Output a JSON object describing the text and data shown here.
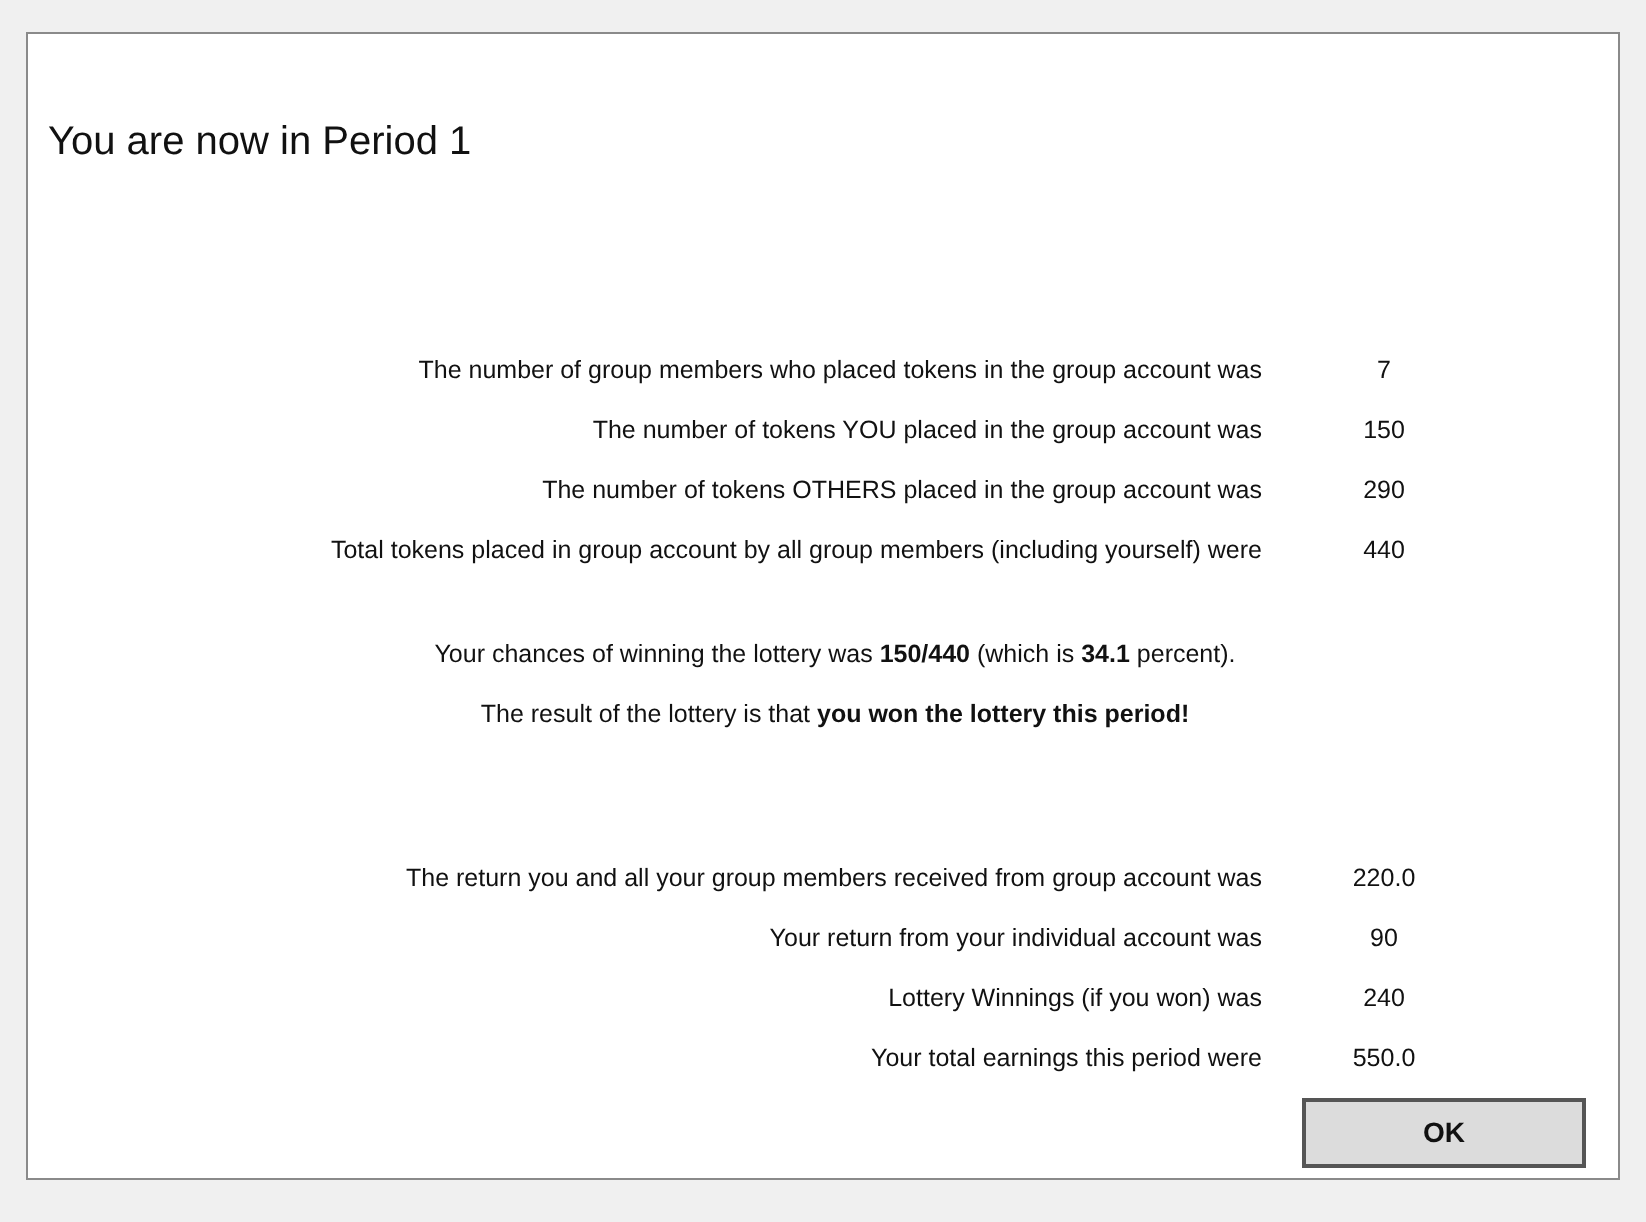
{
  "title": "You are now in Period 1",
  "token_rows": [
    {
      "label": "The number of group members who placed tokens in the group account was",
      "value": "7"
    },
    {
      "label": "The number of tokens YOU placed in the group account was",
      "value": "150"
    },
    {
      "label": "The number of tokens OTHERS placed in the group account was",
      "value": "290"
    },
    {
      "label": "Total tokens placed in group account by all group members (including yourself) were",
      "value": "440"
    }
  ],
  "lottery_lines": [
    "Your chances of winning the lottery was **150/440** (which is **34.1** percent).",
    "The result of the lottery is that **you won the lottery this period!**"
  ],
  "earnings_rows": [
    {
      "label": "The return you and all your group members received from group account was",
      "value": "220.0"
    },
    {
      "label": "Your return from your individual account was",
      "value": "90"
    },
    {
      "label": "Lottery Winnings (if you won) was",
      "value": "240"
    },
    {
      "label": "Your total earnings this period were",
      "value": "550.0"
    }
  ],
  "button": "OK"
}
